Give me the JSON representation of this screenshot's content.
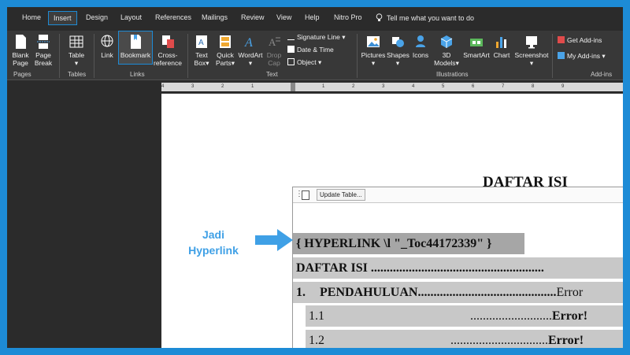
{
  "tabs": [
    "Home",
    "Insert",
    "Design",
    "Layout",
    "References",
    "Mailings",
    "Review",
    "View",
    "Help",
    "Nitro Pro"
  ],
  "tell_me": "Tell me what you want to do",
  "ribbon": {
    "blank_page": [
      "Blank",
      "Page"
    ],
    "page_break": [
      "Page",
      "Break"
    ],
    "table": "Table",
    "link": "Link",
    "bookmark": "Bookmark",
    "cross_reference": [
      "Cross-",
      "reference"
    ],
    "text_box": [
      "Text",
      "Box"
    ],
    "quick_parts": [
      "Quick",
      "Parts"
    ],
    "wordart": "WordArt",
    "drop_cap": [
      "Drop",
      "Cap"
    ],
    "signature_line": "Signature Line",
    "date_time": "Date & Time",
    "object": "Object",
    "pictures": "Pictures",
    "shapes": "Shapes",
    "icons": "Icons",
    "models_3d": [
      "3D",
      "Models"
    ],
    "smartart": "SmartArt",
    "chart": "Chart",
    "screenshot": "Screenshot",
    "get_addins": "Get Add-ins",
    "my_addins": "My Add-ins",
    "groups": {
      "pages": "Pages",
      "tables": "Tables",
      "links": "Links",
      "text": "Text",
      "illustrations": "Illustrations",
      "addins": "Add-ins"
    }
  },
  "ruler_ticks": [
    "4",
    "3",
    "2",
    "1",
    "1",
    "2",
    "3",
    "4",
    "5",
    "6",
    "7",
    "8",
    "9"
  ],
  "document": {
    "title": "DAFTAR ISI",
    "update_table": "Update Table...",
    "hyperlink_field": "{ HYPERLINK \\l \"_Toc44172339\" }",
    "toc_line1": "DAFTAR ISI .......................................................",
    "toc_line2_num": "1.",
    "toc_line2_text": "PENDAHULUAN",
    "toc_line2_dots": "............................................",
    "toc_line2_err": "Error",
    "toc_line3_num": "1.1",
    "toc_line3_dots": "..........................",
    "toc_line3_err": "Error!",
    "toc_line4_num": "1.2",
    "toc_line4_dots": "...............................",
    "toc_line4_err": "Error!"
  },
  "annotation": [
    "Jadi",
    "Hyperlink"
  ],
  "colors": {
    "accent": "#1d8bd6",
    "ribbon_bg": "#383838",
    "arrow": "#3fa0e6"
  }
}
